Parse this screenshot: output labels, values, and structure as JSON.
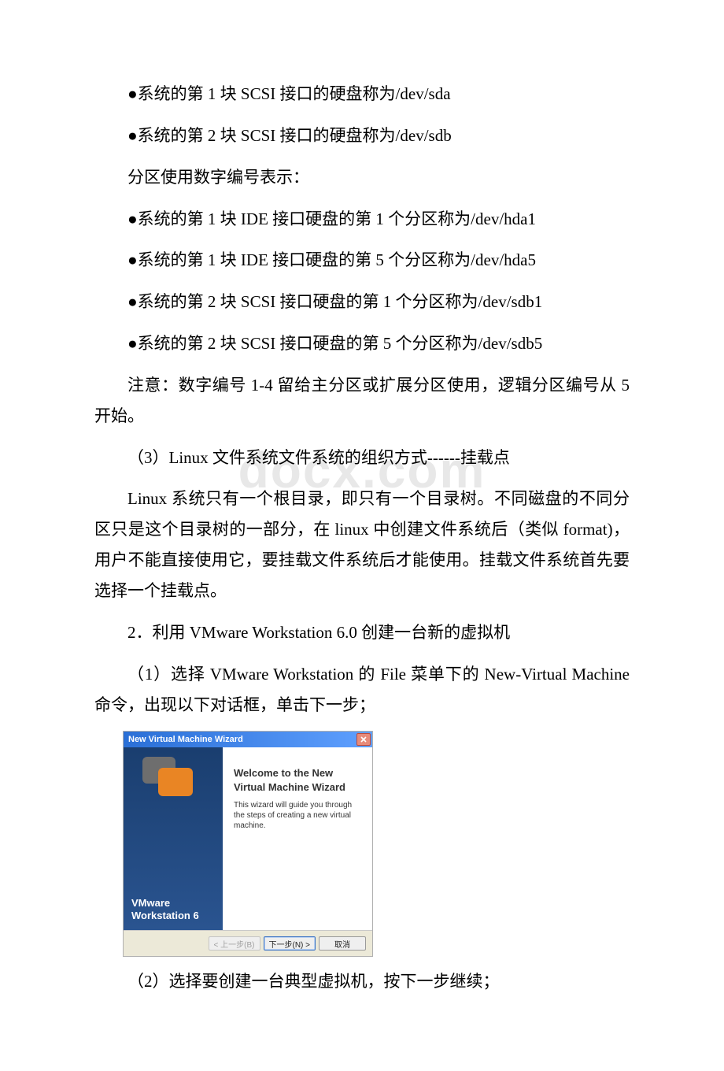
{
  "watermark": "docx.com",
  "paragraphs": {
    "p1": "●系统的第 1 块 SCSI 接口的硬盘称为/dev/sda",
    "p2": "●系统的第 2 块 SCSI 接口的硬盘称为/dev/sdb",
    "p3": "分区使用数字编号表示：",
    "p4": "●系统的第 1 块 IDE 接口硬盘的第 1 个分区称为/dev/hda1",
    "p5": "●系统的第 1 块 IDE 接口硬盘的第 5 个分区称为/dev/hda5",
    "p6": "●系统的第 2 块 SCSI 接口硬盘的第 1 个分区称为/dev/sdb1",
    "p7": "●系统的第 2 块 SCSI 接口硬盘的第 5 个分区称为/dev/sdb5",
    "p8": "注意：数字编号 1-4 留给主分区或扩展分区使用，逻辑分区编号从 5 开始。",
    "p9": "（3）Linux 文件系统文件系统的组织方式------挂载点",
    "p10": "Linux 系统只有一个根目录，即只有一个目录树。不同磁盘的不同分区只是这个目录树的一部分，在 linux 中创建文件系统后（类似 format)，用户不能直接使用它，要挂载文件系统后才能使用。挂载文件系统首先要选择一个挂载点。",
    "p11": "2．利用 VMware Workstation 6.0 创建一台新的虚拟机",
    "p12": "（1）选择 VMware Workstation 的 File 菜单下的 New-Virtual Machine 命令，出现以下对话框，单击下一步；",
    "p13": "（2）选择要创建一台典型虚拟机，按下一步继续；"
  },
  "wizard": {
    "title": "New Virtual Machine Wizard",
    "brand_line1": "VMware",
    "brand_line2": "Workstation 6",
    "heading_line1": "Welcome to the New",
    "heading_line2": "Virtual Machine Wizard",
    "desc": "This wizard will guide you through the steps of creating a new virtual machine.",
    "buttons": {
      "back": "< 上一步(B)",
      "next": "下一步(N) >",
      "cancel": "取消"
    }
  }
}
